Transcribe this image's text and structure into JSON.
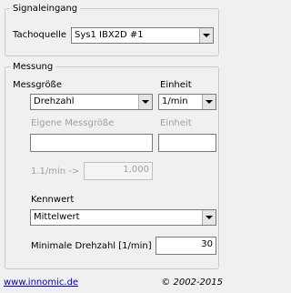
{
  "signaleingang": {
    "legend": "Signaleingang",
    "tachoquelle_label": "Tachoquelle",
    "tachoquelle_value": "Sys1 IBX2D #1"
  },
  "messung": {
    "legend": "Messung",
    "messgroesse_label": "Messgröße",
    "messgroesse_value": "Drehzahl",
    "einheit_label": "Einheit",
    "einheit_value": "1/min",
    "eigene_messgroesse_label": "Eigene Messgröße",
    "eigene_messgroesse_value": "",
    "einheit2_label": "Einheit",
    "einheit2_value": "",
    "factor_label": "1.1/min ->",
    "factor_value": "1,000",
    "kennwert_label": "Kennwert",
    "kennwert_value": "Mittelwert",
    "minimale_drehzahl_label": "Minimale Drehzahl [1/min]",
    "minimale_drehzahl_value": "30"
  },
  "footer": {
    "link": "www.innomic.de",
    "copyright": "© 2002-2015"
  },
  "colors": {
    "link": "#0000cc",
    "disabled_text": "#a0a0a0",
    "background": "#f0f0f0"
  }
}
